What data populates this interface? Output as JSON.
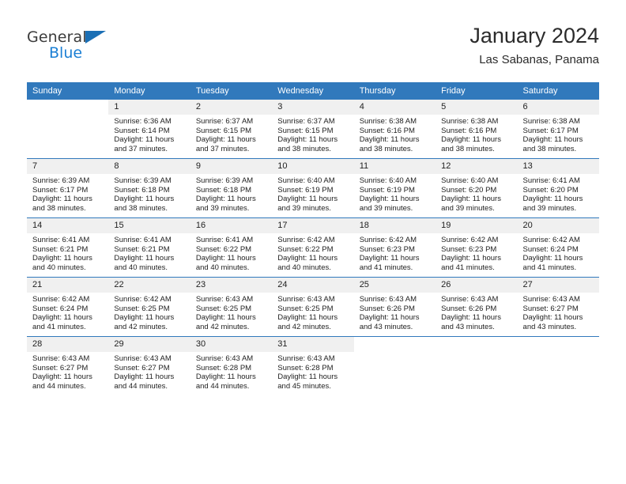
{
  "brand": {
    "name_top": "General",
    "name_bottom": "Blue",
    "triangle_color": "#1b6fb5",
    "blue_color": "#1b7fd4"
  },
  "header": {
    "month_title": "January 2024",
    "location": "Las Sabanas, Panama"
  },
  "theme": {
    "header_bg": "#3179bc",
    "daynum_bg": "#f0f0f0",
    "grid_line": "#3179bc"
  },
  "calendar": {
    "weekday_headers": [
      "Sunday",
      "Monday",
      "Tuesday",
      "Wednesday",
      "Thursday",
      "Friday",
      "Saturday"
    ],
    "weeks": [
      [
        {
          "day": "",
          "lines": []
        },
        {
          "day": "1",
          "lines": [
            "Sunrise: 6:36 AM",
            "Sunset: 6:14 PM",
            "Daylight: 11 hours",
            "and 37 minutes."
          ]
        },
        {
          "day": "2",
          "lines": [
            "Sunrise: 6:37 AM",
            "Sunset: 6:15 PM",
            "Daylight: 11 hours",
            "and 37 minutes."
          ]
        },
        {
          "day": "3",
          "lines": [
            "Sunrise: 6:37 AM",
            "Sunset: 6:15 PM",
            "Daylight: 11 hours",
            "and 38 minutes."
          ]
        },
        {
          "day": "4",
          "lines": [
            "Sunrise: 6:38 AM",
            "Sunset: 6:16 PM",
            "Daylight: 11 hours",
            "and 38 minutes."
          ]
        },
        {
          "day": "5",
          "lines": [
            "Sunrise: 6:38 AM",
            "Sunset: 6:16 PM",
            "Daylight: 11 hours",
            "and 38 minutes."
          ]
        },
        {
          "day": "6",
          "lines": [
            "Sunrise: 6:38 AM",
            "Sunset: 6:17 PM",
            "Daylight: 11 hours",
            "and 38 minutes."
          ]
        }
      ],
      [
        {
          "day": "7",
          "lines": [
            "Sunrise: 6:39 AM",
            "Sunset: 6:17 PM",
            "Daylight: 11 hours",
            "and 38 minutes."
          ]
        },
        {
          "day": "8",
          "lines": [
            "Sunrise: 6:39 AM",
            "Sunset: 6:18 PM",
            "Daylight: 11 hours",
            "and 38 minutes."
          ]
        },
        {
          "day": "9",
          "lines": [
            "Sunrise: 6:39 AM",
            "Sunset: 6:18 PM",
            "Daylight: 11 hours",
            "and 39 minutes."
          ]
        },
        {
          "day": "10",
          "lines": [
            "Sunrise: 6:40 AM",
            "Sunset: 6:19 PM",
            "Daylight: 11 hours",
            "and 39 minutes."
          ]
        },
        {
          "day": "11",
          "lines": [
            "Sunrise: 6:40 AM",
            "Sunset: 6:19 PM",
            "Daylight: 11 hours",
            "and 39 minutes."
          ]
        },
        {
          "day": "12",
          "lines": [
            "Sunrise: 6:40 AM",
            "Sunset: 6:20 PM",
            "Daylight: 11 hours",
            "and 39 minutes."
          ]
        },
        {
          "day": "13",
          "lines": [
            "Sunrise: 6:41 AM",
            "Sunset: 6:20 PM",
            "Daylight: 11 hours",
            "and 39 minutes."
          ]
        }
      ],
      [
        {
          "day": "14",
          "lines": [
            "Sunrise: 6:41 AM",
            "Sunset: 6:21 PM",
            "Daylight: 11 hours",
            "and 40 minutes."
          ]
        },
        {
          "day": "15",
          "lines": [
            "Sunrise: 6:41 AM",
            "Sunset: 6:21 PM",
            "Daylight: 11 hours",
            "and 40 minutes."
          ]
        },
        {
          "day": "16",
          "lines": [
            "Sunrise: 6:41 AM",
            "Sunset: 6:22 PM",
            "Daylight: 11 hours",
            "and 40 minutes."
          ]
        },
        {
          "day": "17",
          "lines": [
            "Sunrise: 6:42 AM",
            "Sunset: 6:22 PM",
            "Daylight: 11 hours",
            "and 40 minutes."
          ]
        },
        {
          "day": "18",
          "lines": [
            "Sunrise: 6:42 AM",
            "Sunset: 6:23 PM",
            "Daylight: 11 hours",
            "and 41 minutes."
          ]
        },
        {
          "day": "19",
          "lines": [
            "Sunrise: 6:42 AM",
            "Sunset: 6:23 PM",
            "Daylight: 11 hours",
            "and 41 minutes."
          ]
        },
        {
          "day": "20",
          "lines": [
            "Sunrise: 6:42 AM",
            "Sunset: 6:24 PM",
            "Daylight: 11 hours",
            "and 41 minutes."
          ]
        }
      ],
      [
        {
          "day": "21",
          "lines": [
            "Sunrise: 6:42 AM",
            "Sunset: 6:24 PM",
            "Daylight: 11 hours",
            "and 41 minutes."
          ]
        },
        {
          "day": "22",
          "lines": [
            "Sunrise: 6:42 AM",
            "Sunset: 6:25 PM",
            "Daylight: 11 hours",
            "and 42 minutes."
          ]
        },
        {
          "day": "23",
          "lines": [
            "Sunrise: 6:43 AM",
            "Sunset: 6:25 PM",
            "Daylight: 11 hours",
            "and 42 minutes."
          ]
        },
        {
          "day": "24",
          "lines": [
            "Sunrise: 6:43 AM",
            "Sunset: 6:25 PM",
            "Daylight: 11 hours",
            "and 42 minutes."
          ]
        },
        {
          "day": "25",
          "lines": [
            "Sunrise: 6:43 AM",
            "Sunset: 6:26 PM",
            "Daylight: 11 hours",
            "and 43 minutes."
          ]
        },
        {
          "day": "26",
          "lines": [
            "Sunrise: 6:43 AM",
            "Sunset: 6:26 PM",
            "Daylight: 11 hours",
            "and 43 minutes."
          ]
        },
        {
          "day": "27",
          "lines": [
            "Sunrise: 6:43 AM",
            "Sunset: 6:27 PM",
            "Daylight: 11 hours",
            "and 43 minutes."
          ]
        }
      ],
      [
        {
          "day": "28",
          "lines": [
            "Sunrise: 6:43 AM",
            "Sunset: 6:27 PM",
            "Daylight: 11 hours",
            "and 44 minutes."
          ]
        },
        {
          "day": "29",
          "lines": [
            "Sunrise: 6:43 AM",
            "Sunset: 6:27 PM",
            "Daylight: 11 hours",
            "and 44 minutes."
          ]
        },
        {
          "day": "30",
          "lines": [
            "Sunrise: 6:43 AM",
            "Sunset: 6:28 PM",
            "Daylight: 11 hours",
            "and 44 minutes."
          ]
        },
        {
          "day": "31",
          "lines": [
            "Sunrise: 6:43 AM",
            "Sunset: 6:28 PM",
            "Daylight: 11 hours",
            "and 45 minutes."
          ]
        },
        {
          "day": "",
          "lines": []
        },
        {
          "day": "",
          "lines": []
        },
        {
          "day": "",
          "lines": []
        }
      ]
    ]
  }
}
